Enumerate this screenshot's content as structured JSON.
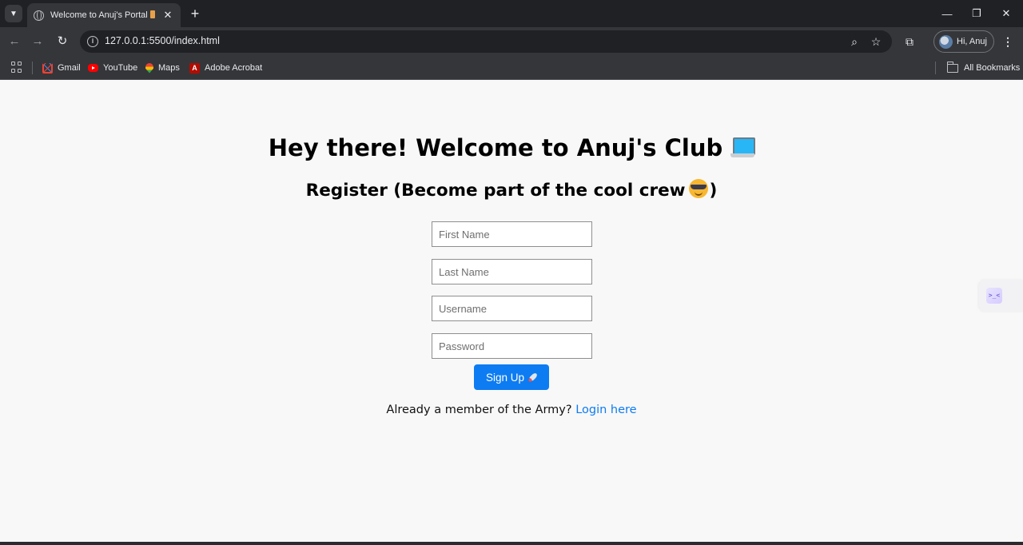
{
  "browser": {
    "tab_title": "Welcome to Anuj's Portal",
    "tab_close": "✕",
    "new_tab": "+",
    "url": "127.0.0.1:5500/index.html",
    "profile_name": "Hi, Anuj",
    "window_controls": {
      "minimize": "—",
      "restore": "❐",
      "close": "✕"
    },
    "bookmarks": [
      {
        "label": "Gmail",
        "icon": "gmail-icon"
      },
      {
        "label": "YouTube",
        "icon": "youtube-icon"
      },
      {
        "label": "Maps",
        "icon": "maps-icon"
      },
      {
        "label": "Adobe Acrobat",
        "icon": "adobe-acrobat-icon"
      }
    ],
    "all_bookmarks": "All Bookmarks"
  },
  "page": {
    "heading": "Hey there! Welcome to Anuj's Club",
    "subheading_before": "Register (Become part of the cool crew",
    "subheading_after": ")",
    "form": {
      "first_name_placeholder": "First Name",
      "last_name_placeholder": "Last Name",
      "username_placeholder": "Username",
      "password_placeholder": "Password",
      "submit_label": "Sign Up"
    },
    "login_prompt": "Already a member of the Army?",
    "login_link": "Login here",
    "side_widget_text": ">_<"
  },
  "colors": {
    "primary": "#0d7cf2",
    "page_background": "#f8f8f8",
    "chrome_dark": "#202124",
    "chrome_toolbar": "#35363a"
  }
}
